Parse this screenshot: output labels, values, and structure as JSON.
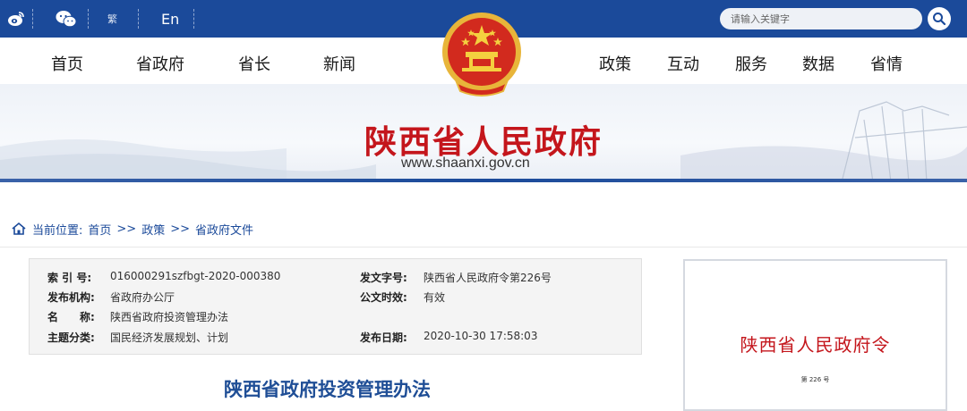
{
  "topbar": {
    "lang_trad": "繁",
    "lang_en": "En",
    "search_placeholder": "请输入关键字"
  },
  "nav": {
    "left": [
      "首页",
      "省政府",
      "省长",
      "新闻"
    ],
    "right": [
      "政策",
      "互动",
      "服务",
      "数据",
      "省情"
    ]
  },
  "banner": {
    "title": "陕西省人民政府",
    "url": "www.shaanxi.gov.cn"
  },
  "breadcrumb": {
    "prefix": "当前位置:",
    "items": [
      "首页",
      ">>",
      "政策",
      ">>",
      "省政府文件"
    ]
  },
  "info": {
    "index_label": "索 引 号:",
    "index_value": "016000291szfbgt-2020-000380",
    "issuer_label": "发布机构:",
    "issuer_value": "省政府办公厅",
    "name_label": "名　　称:",
    "name_value": "陕西省政府投资管理办法",
    "topic_label": "主题分类:",
    "topic_value": "国民经济发展规划、计划",
    "docno_label": "发文字号:",
    "docno_value": "陕西省人民政府令第226号",
    "validity_label": "公文时效:",
    "validity_value": "有效",
    "date_label": "发布日期:",
    "date_value": "2020-10-30 17:58:03"
  },
  "document": {
    "title": "陕西省政府投资管理办法"
  },
  "preview": {
    "title": "陕西省人民政府令",
    "number": "第 226 号"
  },
  "colors": {
    "topbar": "#1b4a9a",
    "accent_red": "#c4161c",
    "link_blue": "#1b4a9a"
  }
}
